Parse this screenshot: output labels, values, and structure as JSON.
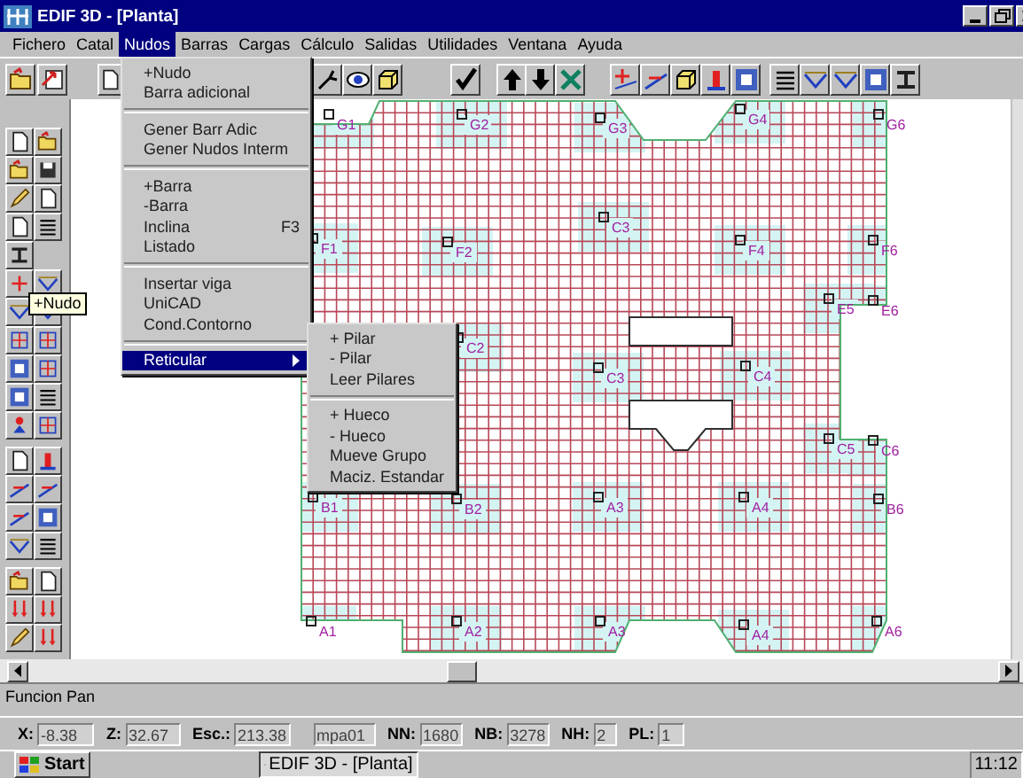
{
  "window": {
    "title": "EDIF 3D - [Planta]"
  },
  "menubar": [
    {
      "label": "Fichero",
      "selected": false
    },
    {
      "label": "Catal",
      "selected": false
    },
    {
      "label": "Nudos",
      "selected": true
    },
    {
      "label": "Barras",
      "selected": false
    },
    {
      "label": "Cargas",
      "selected": false
    },
    {
      "label": "Cálculo",
      "selected": false
    },
    {
      "label": "Salidas",
      "selected": false
    },
    {
      "label": "Utilidades",
      "selected": false
    },
    {
      "label": "Ventana",
      "selected": false
    },
    {
      "label": "Ayuda",
      "selected": false
    }
  ],
  "nudos_menu": {
    "groups": [
      {
        "items": [
          {
            "label": "+Nudo",
            "selected": false,
            "submenu": false
          },
          {
            "label": "Barra adicional",
            "selected": false,
            "submenu": false
          }
        ]
      },
      {
        "items": [
          {
            "label": "Gener Barr Adic",
            "selected": false,
            "submenu": false
          },
          {
            "label": "Gener Nudos Interm",
            "selected": false,
            "submenu": false
          }
        ]
      },
      {
        "items": [
          {
            "label": "+Barra",
            "selected": false,
            "submenu": false
          },
          {
            "label": "-Barra",
            "selected": false,
            "submenu": false
          },
          {
            "label": "Inclina",
            "shortcut": "F3",
            "selected": false,
            "submenu": false
          },
          {
            "label": "Listado",
            "selected": false,
            "submenu": false
          }
        ]
      },
      {
        "items": [
          {
            "label": "Insertar viga",
            "selected": false,
            "submenu": false
          },
          {
            "label": "UniCAD",
            "selected": false,
            "submenu": false
          },
          {
            "label": "Cond.Contorno",
            "selected": false,
            "submenu": false
          }
        ]
      },
      {
        "items": [
          {
            "label": "Reticular",
            "selected": true,
            "submenu": true
          }
        ]
      }
    ]
  },
  "reticular_menu": {
    "groups": [
      {
        "items": [
          {
            "label": "+ Pilar",
            "selected": false,
            "submenu": false
          },
          {
            "label": "- Pilar",
            "selected": false,
            "submenu": false
          },
          {
            "label": "Leer Pilares",
            "selected": false,
            "submenu": false
          }
        ]
      },
      {
        "items": [
          {
            "label": "+ Hueco",
            "selected": false,
            "submenu": false
          },
          {
            "label": "- Hueco",
            "selected": false,
            "submenu": false
          },
          {
            "label": "Mueve Grupo",
            "selected": false,
            "submenu": false
          },
          {
            "label": "Maciz. Estandar",
            "selected": false,
            "submenu": false
          }
        ]
      }
    ]
  },
  "tooltip": "+Nudo",
  "pillars": [
    "G1",
    "G2",
    "G3",
    "G4",
    "G6",
    "C3",
    "F1",
    "F2",
    "F4",
    "F6",
    "E5",
    "E6",
    "C2",
    "C3",
    "C4",
    "C5",
    "C6",
    "B1",
    "B2",
    "A3",
    "A4",
    "B6",
    "A1",
    "A2",
    "A3",
    "A4",
    "A6"
  ],
  "status_message": "Funcion Pan",
  "status_fields": [
    {
      "label": "X:",
      "value": "-8.38"
    },
    {
      "label": "Z:",
      "value": "32.67"
    },
    {
      "label": "Esc.:",
      "value": "213.38"
    },
    {
      "value": "mpa01"
    },
    {
      "label": "NN:",
      "value": "1680"
    },
    {
      "label": "NB:",
      "value": "3278"
    },
    {
      "label": "NH:",
      "value": "2"
    },
    {
      "label": "PL:",
      "value": "1"
    }
  ],
  "taskbar": {
    "start": "Start",
    "tasks": [
      {
        "label": "EDIF 3D - [Planta]",
        "selected": true
      }
    ],
    "clock": "11:12"
  }
}
